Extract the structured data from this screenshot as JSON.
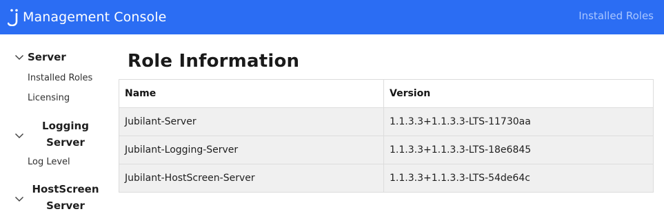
{
  "header": {
    "app_title": "Management Console",
    "current_page": "Installed Roles",
    "brand_color": "#2b6df3"
  },
  "sidebar": {
    "groups": [
      {
        "label": "Server",
        "icon": "chevron-down-icon",
        "items": [
          "Installed Roles",
          "Licensing"
        ]
      },
      {
        "label_line1": "Logging",
        "label_line2": "Server",
        "icon": "chevron-down-icon",
        "items": [
          "Log Level"
        ]
      },
      {
        "label_line1": "HostScreen",
        "label_line2": "Server",
        "icon": "chevron-down-icon",
        "items": []
      }
    ]
  },
  "main": {
    "title": "Role Information",
    "table": {
      "headers": [
        "Name",
        "Version"
      ],
      "rows": [
        [
          "Jubilant-Server",
          "1.1.3.3+1.1.3.3-LTS-11730aa"
        ],
        [
          "Jubilant-Logging-Server",
          "1.1.3.3+1.1.3.3-LTS-18e6845"
        ],
        [
          "Jubilant-HostScreen-Server",
          "1.1.3.3+1.1.3.3-LTS-54de64c"
        ]
      ]
    }
  }
}
